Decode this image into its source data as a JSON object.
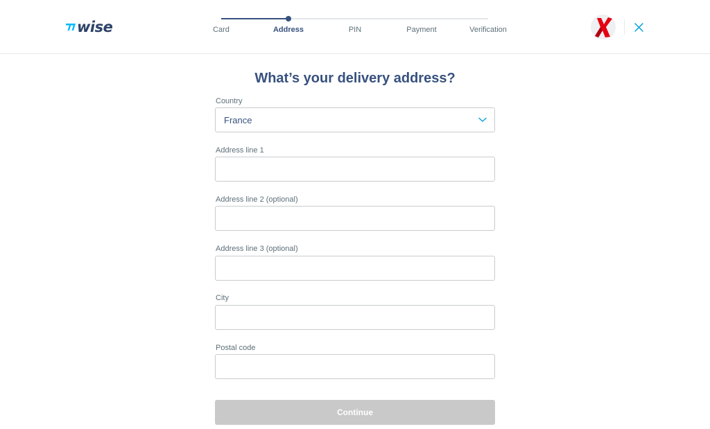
{
  "brand": {
    "name": "wise",
    "icon": "wise-flag-icon"
  },
  "stepper": {
    "steps": [
      {
        "label": "Card",
        "state": "completed"
      },
      {
        "label": "Address",
        "state": "active"
      },
      {
        "label": "PIN",
        "state": "upcoming"
      },
      {
        "label": "Payment",
        "state": "upcoming"
      },
      {
        "label": "Verification",
        "state": "upcoming"
      }
    ],
    "progress": 0.25
  },
  "header": {
    "avatar_icon": "red-x-avatar-icon",
    "close_icon": "close-icon"
  },
  "form": {
    "title": "What’s your delivery address?",
    "country": {
      "label": "Country",
      "value": "France"
    },
    "address_line_1": {
      "label": "Address line 1",
      "value": ""
    },
    "address_line_2": {
      "label": "Address line 2 (optional)",
      "value": ""
    },
    "address_line_3": {
      "label": "Address line 3 (optional)",
      "value": ""
    },
    "city": {
      "label": "City",
      "value": ""
    },
    "postal_code": {
      "label": "Postal code",
      "value": ""
    },
    "submit_label": "Continue"
  },
  "colors": {
    "primary_navy": "#37517e",
    "accent_blue": "#00b9ff",
    "disabled_button": "#c9c9c9",
    "input_border": "#c9cbce",
    "avatar_x_red": "#e60012"
  }
}
